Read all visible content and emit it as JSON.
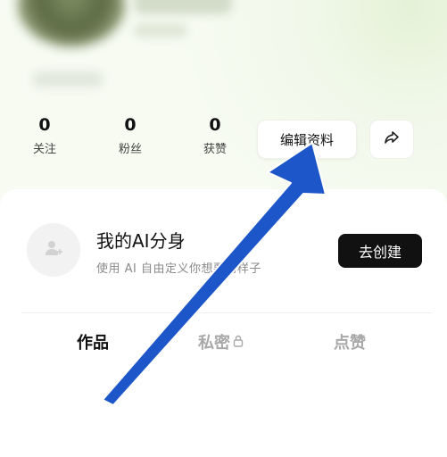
{
  "stats": [
    {
      "value": "0",
      "label": "关注"
    },
    {
      "value": "0",
      "label": "粉丝"
    },
    {
      "value": "0",
      "label": "获赞"
    }
  ],
  "actions": {
    "edit_profile_label": "编辑资料",
    "share_icon": "share-arrow-icon"
  },
  "ai_card": {
    "title": "我的AI分身",
    "subtitle": "使用 AI 自由定义你想要的样子",
    "create_label": "去创建",
    "avatar_icon": "user-plus-icon"
  },
  "tabs": [
    {
      "label": "作品",
      "active": true
    },
    {
      "label": "私密",
      "icon": "lock-icon"
    },
    {
      "label": "点赞"
    }
  ],
  "annotation": {
    "color": "#1c56c9",
    "icon": "pointer-arrow"
  }
}
